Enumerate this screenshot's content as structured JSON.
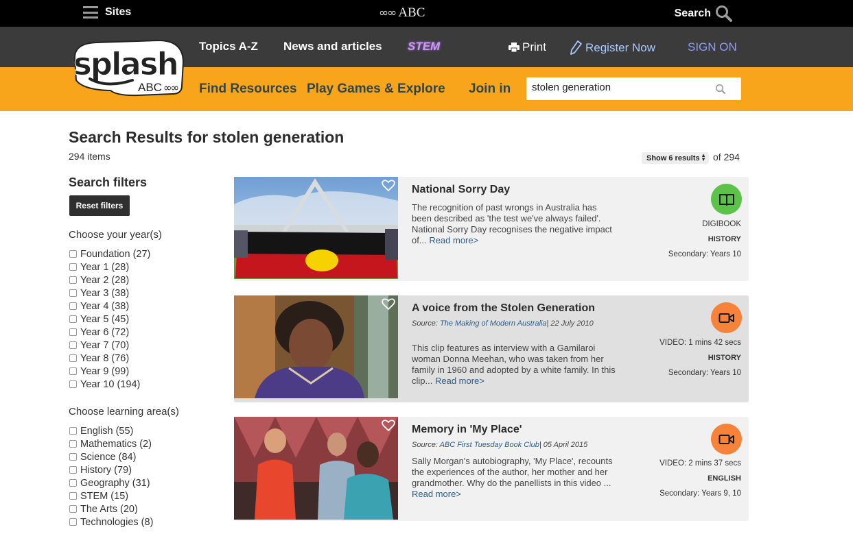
{
  "top_bar": {
    "sites_label": "Sites",
    "abc_logo_text": "ABC",
    "search_label": "Search"
  },
  "splash_nav": {
    "topics": "Topics A-Z",
    "news": "News and articles",
    "stem": "STEM",
    "print": "Print",
    "register": "Register Now",
    "sign_on": "SIGN ON"
  },
  "logo": {
    "word": "splash",
    "sub": "ABC"
  },
  "orange_nav": {
    "find_resources": "Find Resources",
    "play_games": "Play Games & Explore",
    "join_in": "Join in"
  },
  "search": {
    "value": "stolen generation"
  },
  "results": {
    "title": "Search Results for stolen generation",
    "count": "294 items",
    "show_select": "Show 6 results",
    "of_total": "of 294"
  },
  "filters": {
    "heading": "Search filters",
    "reset_label": "Reset filters",
    "year_title": "Choose your year(s)",
    "years": [
      "Foundation (27)",
      "Year 1 (28)",
      "Year 2 (28)",
      "Year 3 (38)",
      "Year 4 (38)",
      "Year 5 (45)",
      "Year 6 (72)",
      "Year 7 (70)",
      "Year 8 (76)",
      "Year 9 (99)",
      "Year 10 (194)"
    ],
    "area_title": "Choose learning area(s)",
    "areas": [
      "English (55)",
      "Mathematics (2)",
      "Science (84)",
      "History (79)",
      "Geography (31)",
      "STEM (15)",
      "The Arts (20)",
      "Technologies (8)"
    ]
  },
  "cards": [
    {
      "title": "National Sorry Day",
      "description": "The recognition of past wrongs in Australia has been described as 'the test we've always failed'. National Sorry Day recognises the negative impact of...",
      "read_more": "Read more>",
      "type": "DIGIBOOK",
      "subject": "HISTORY",
      "level": "Secondary: Years 10",
      "badge_icon": "book-icon",
      "badge_color": "#5cc24a"
    },
    {
      "title": "A voice from the Stolen Generation",
      "source_prefix": "Source:",
      "source_link": "The Making of Modern Australia",
      "source_date": "22 July 2010",
      "description": "This clip features as interview with a Gamilaroi woman Donna Meehan, who was taken from her family in 1960 and adopted by a white family. In this clip...",
      "read_more": "Read more>",
      "type": "VIDEO: 1 mins 42 secs",
      "subject": "HISTORY",
      "level": "Secondary: Years 10",
      "badge_icon": "video-camera-icon",
      "badge_color": "#f7823a"
    },
    {
      "title": "Memory in 'My Place'",
      "source_prefix": "Source:",
      "source_link": "ABC First Tuesday Book Club",
      "source_date": "05 April 2015",
      "description": "Sally Morgan's autobiography, 'My Place', recounts the experiences of the author, her mother and her grandmother. Why do the panellists in this video ...",
      "read_more": "Read more>",
      "type": "VIDEO: 2 mins 37 secs",
      "subject": "ENGLISH",
      "level": "Secondary: Years 9, 10",
      "badge_icon": "video-camera-icon",
      "badge_color": "#f7823a"
    }
  ]
}
